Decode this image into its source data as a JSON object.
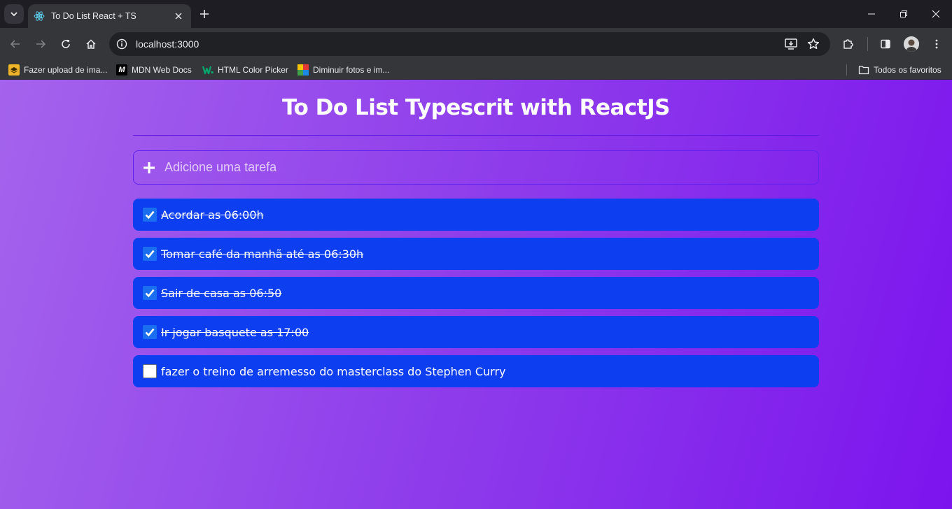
{
  "browser": {
    "tab_title": "To Do List React + TS",
    "url": "localhost:3000",
    "bookmarks": [
      {
        "label": "Fazer upload de ima...",
        "icon": "upload-layers-icon"
      },
      {
        "label": "MDN Web Docs",
        "icon": "mdn-icon"
      },
      {
        "label": "HTML Color Picker",
        "icon": "w3schools-icon"
      },
      {
        "label": "Diminuir fotos e im...",
        "icon": "easy-resize-icon"
      }
    ],
    "all_bookmarks_label": "Todos os favoritos"
  },
  "app": {
    "title": "To Do List Typescrit with ReactJS",
    "add_placeholder": "Adicione uma tarefa",
    "tasks": [
      {
        "text": "Acordar as 06:00h",
        "done": true
      },
      {
        "text": "Tomar café da manhã até as 06:30h",
        "done": true
      },
      {
        "text": "Sair de casa as 06:50",
        "done": true
      },
      {
        "text": "Ir jogar basquete as 17:00",
        "done": true
      },
      {
        "text": "fazer o treino de arremesso do masterclass do Stephen Curry",
        "done": false
      }
    ]
  },
  "colors": {
    "page_gradient_start": "#a463ec",
    "page_gradient_end": "#7c14ee",
    "task_background": "#0d3ef0",
    "input_border": "#5f22ef",
    "checkbox_checked": "#1a6ff0"
  }
}
